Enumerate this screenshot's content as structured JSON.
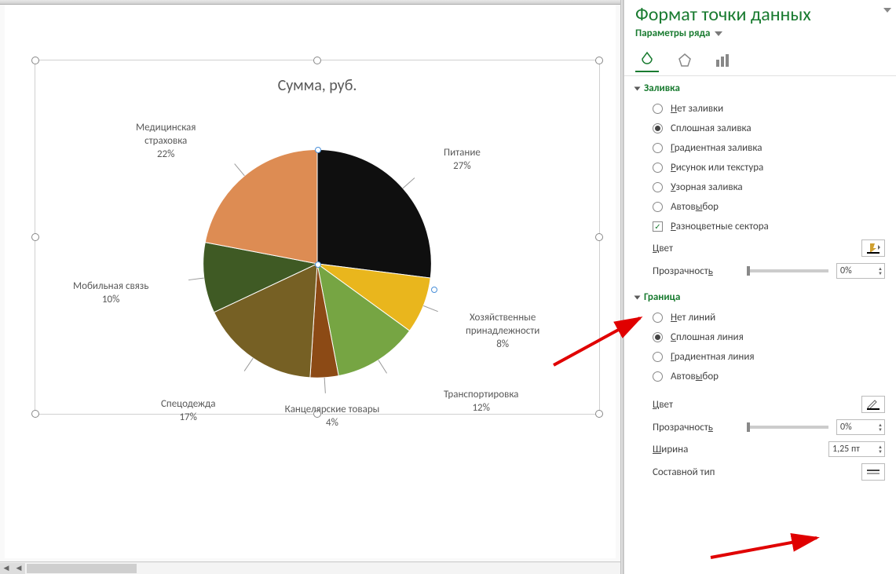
{
  "chart_data": {
    "type": "pie",
    "title": "Сумма, руб.",
    "categories": [
      "Питание",
      "Хозяйственные принадлежности",
      "Транспортировка",
      "Канцелярские товары",
      "Спецодежда",
      "Мобильная связь",
      "Медицинская страховка"
    ],
    "values": [
      27,
      8,
      12,
      4,
      17,
      10,
      22
    ],
    "unit": "%",
    "colors": [
      "#0f0f0f",
      "#e9b61d",
      "#76a543",
      "#8c4a15",
      "#766024",
      "#3f5a24",
      "#dd8c53"
    ],
    "selected_slice_index": 0
  },
  "chart": {
    "title": "Сумма, руб.",
    "labels": [
      {
        "name": "Питание",
        "pct": "27%"
      },
      {
        "name": "Хозяйственные\nпринадлежности",
        "pct": "8%"
      },
      {
        "name": "Транспортировка",
        "pct": "12%"
      },
      {
        "name": "Канцелярские товары",
        "pct": "4%"
      },
      {
        "name": "Спецодежда",
        "pct": "17%"
      },
      {
        "name": "Мобильная связь",
        "pct": "10%"
      },
      {
        "name": "Медицинская\nстраховка",
        "pct": "22%"
      }
    ]
  },
  "pane": {
    "title": "Формат точки данных",
    "subtitle": "Параметры ряда",
    "sections": {
      "fill": {
        "title": "Заливка",
        "options": {
          "none": "Нет заливки",
          "solid": "Сплошная заливка",
          "gradient": "Градиентная заливка",
          "picture": "Рисунок или текстура",
          "pattern": "Узорная заливка",
          "auto": "Автовыбор",
          "vary": "Разноцветные сектора"
        },
        "selected": "solid",
        "vary_checked": true,
        "color_label": "Цвет",
        "transparency_label": "Прозрачность",
        "transparency_value": "0%"
      },
      "border": {
        "title": "Граница",
        "options": {
          "none": "Нет линий",
          "solid": "Сплошная линия",
          "gradient": "Градиентная линия",
          "auto": "Автовыбор"
        },
        "selected": "solid",
        "color_label": "Цвет",
        "transparency_label": "Прозрачность",
        "transparency_value": "0%",
        "width_label": "Ширина",
        "width_value": "1,25 пт",
        "compound_label": "Составной тип"
      }
    }
  }
}
